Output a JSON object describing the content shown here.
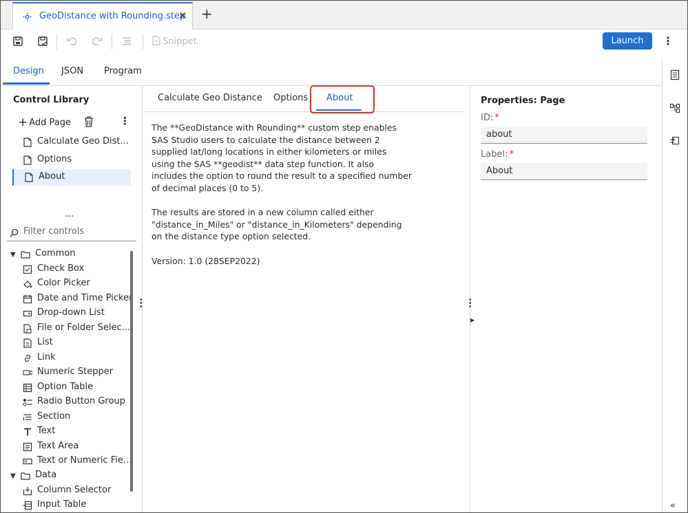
{
  "doc_tab": {
    "title": "GeoDistance with Rounding.step",
    "close": "✕",
    "new_tab": "+"
  },
  "toolbar": {
    "snippet_label": "Snippet",
    "launch_label": "Launch",
    "more": "⋮"
  },
  "view_tabs": [
    {
      "label": "Design"
    },
    {
      "label": "JSON"
    },
    {
      "label": "Program"
    }
  ],
  "control_library": {
    "title": "Control Library",
    "add_page_label": "Add Page",
    "pages": [
      {
        "label": "Calculate Geo Dist..."
      },
      {
        "label": "Options"
      },
      {
        "label": "About"
      }
    ],
    "filter_placeholder": "Filter controls",
    "groups": [
      {
        "label": "Common"
      },
      {
        "label": "Data"
      }
    ],
    "common_items": [
      {
        "label": "Check Box",
        "icon": "checkbox-icon"
      },
      {
        "label": "Color Picker",
        "icon": "paint-bucket-icon"
      },
      {
        "label": "Date and Time Picker",
        "icon": "calendar-icon"
      },
      {
        "label": "Drop-down List",
        "icon": "dropdown-icon"
      },
      {
        "label": "File or Folder Selec...",
        "icon": "file-folder-icon"
      },
      {
        "label": "List",
        "icon": "list-icon"
      },
      {
        "label": "Link",
        "icon": "link-icon"
      },
      {
        "label": "Numeric Stepper",
        "icon": "stepper-icon"
      },
      {
        "label": "Option Table",
        "icon": "option-table-icon"
      },
      {
        "label": "Radio Button Group",
        "icon": "radio-group-icon"
      },
      {
        "label": "Section",
        "icon": "section-icon"
      },
      {
        "label": "Text",
        "icon": "text-icon"
      },
      {
        "label": "Text Area",
        "icon": "text-area-icon"
      },
      {
        "label": "Text or Numeric Fie...",
        "icon": "text-field-icon"
      }
    ],
    "data_items": [
      {
        "label": "Column Selector",
        "icon": "column-selector-icon"
      },
      {
        "label": "Input Table",
        "icon": "input-table-icon"
      }
    ]
  },
  "page_tabs": [
    {
      "label": "Calculate Geo Distance"
    },
    {
      "label": "Options"
    },
    {
      "label": "About"
    }
  ],
  "about": {
    "text": "The **GeoDistance with Rounding** custom step enables SAS Studio users to calculate the distance between 2 supplied lat/long locations in either kilometers or miles using the SAS **geodist** data step function.  It also includes the option to round the result to a specified number of decimal places (0 to 5).\n\nThe results are stored in a new column called either \"distance_in_Miles\" or \"distance_in_Kilometers\" depending on the distance type option selected.\n\nVersion: 1.0 (28SEP2022)"
  },
  "properties": {
    "title": "Properties: Page",
    "id_label": "ID:",
    "id_value": "about",
    "label_label": "Label:",
    "label_value": "About",
    "required_mark": "*"
  },
  "rail": {
    "collapse": "«"
  },
  "colors": {
    "accent": "#1f6fd1",
    "highlight": "#e02c2c"
  }
}
